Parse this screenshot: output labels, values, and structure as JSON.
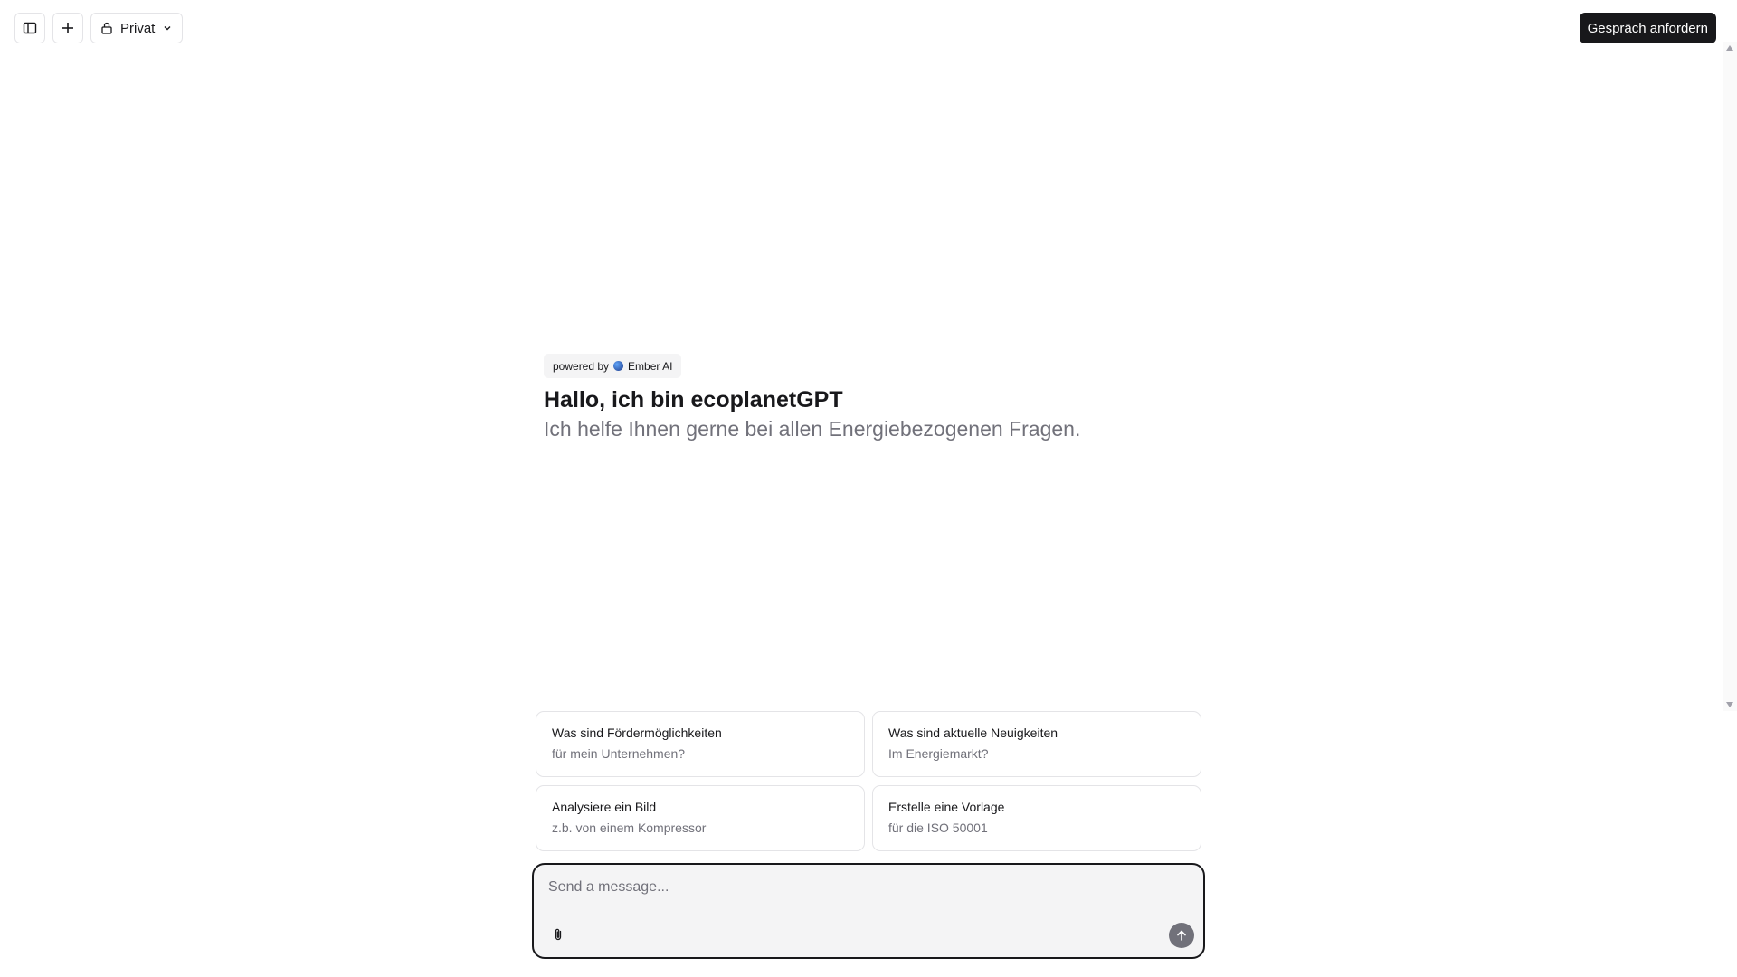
{
  "header": {
    "privacy_label": "Privat",
    "cta_label": "Gespräch anfordern",
    "icons": [
      "sidebar-toggle-icon",
      "plus-icon",
      "lock-icon",
      "chevron-down-icon"
    ]
  },
  "greeting": {
    "powered_by": "powered by",
    "brand": "Ember AI",
    "title": "Hallo, ich bin ecoplanetGPT",
    "subtitle": "Ich helfe Ihnen gerne bei allen Energiebezogenen Fragen."
  },
  "suggestions": [
    {
      "title": "Was sind Fördermöglichkeiten",
      "sub": "für mein Unternehmen?"
    },
    {
      "title": "Was sind aktuelle Neuigkeiten",
      "sub": "Im Energiemarkt?"
    },
    {
      "title": "Analysiere ein Bild",
      "sub": "z.b. von einem Kompressor"
    },
    {
      "title": "Erstelle eine Vorlage",
      "sub": "für die ISO 50001"
    }
  ],
  "composer": {
    "placeholder": "Send a message...",
    "value": ""
  },
  "colors": {
    "text": "#18181b",
    "muted": "#71717a",
    "border": "#e4e4e7",
    "cta_bg": "#18181b",
    "composer_bg": "#f4f4f5"
  }
}
